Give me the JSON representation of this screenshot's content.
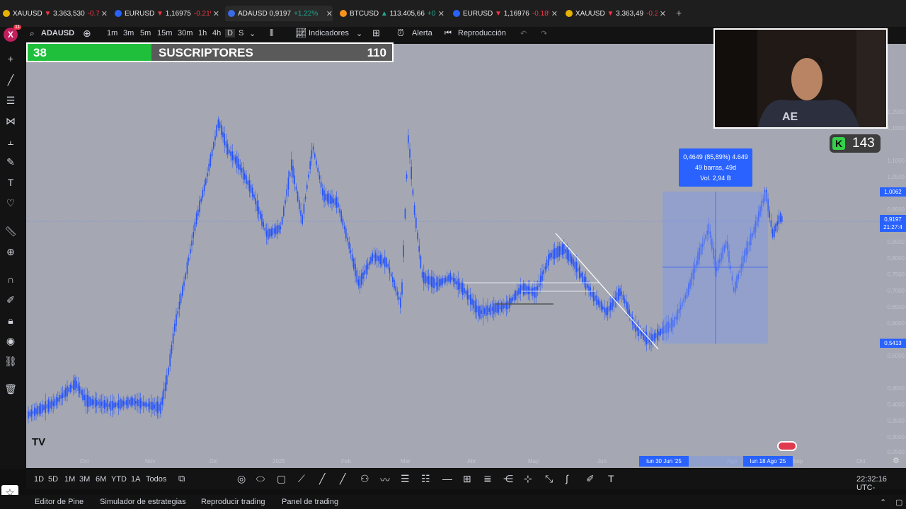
{
  "tabs": [
    {
      "symbol": "XAUUSD",
      "price": "3.363,530",
      "change": "-0.7",
      "dir": "neg",
      "coin": "#e8b200"
    },
    {
      "symbol": "EURUSD",
      "price": "1,16975",
      "change": "-0.21%",
      "dir": "neg",
      "coin": "#2962ff"
    },
    {
      "symbol": "ADAUSD",
      "price": "0,9197",
      "change": "+1.22%",
      "dir": "pos",
      "coin": "#3b6ce8"
    },
    {
      "symbol": "BTCUSD",
      "price": "113.405,66",
      "change": "+0.0",
      "dir": "pos",
      "coin": "#f7931a"
    },
    {
      "symbol": "EURUSD",
      "price": "1,16976",
      "change": "-0.18%",
      "dir": "neg",
      "coin": "#2962ff"
    },
    {
      "symbol": "XAUUSD",
      "price": "3.363,49",
      "change": "-0.2",
      "dir": "neg",
      "coin": "#e8b200"
    }
  ],
  "toolbar": {
    "badge": "11",
    "symbol": "ADAUSD",
    "timeframes": [
      "1m",
      "3m",
      "5m",
      "15m",
      "30m",
      "1h",
      "4h",
      "D",
      "S"
    ],
    "indicators": "Indicadores",
    "alert": "Alerta",
    "replay": "Reproducción"
  },
  "overlay": {
    "current": "38",
    "label": "SUSCRIPTORES",
    "goal": "110",
    "kick_count": "143"
  },
  "chart": {
    "measure_line1": "0,4649 (85,89%) 4.649",
    "measure_line2": "49 barras, 49d",
    "measure_line3": "Vol. 2,94 B",
    "price_high": "1,0062",
    "price_current": "0,9197",
    "countdown": "21:27:4",
    "price_low": "0,5413",
    "date_start": "lun 30 Jun '25",
    "date_end": "lun 18 Ago '25",
    "price_ticks": [
      "1,2500",
      "1,1500",
      "1,1000",
      "1,0500",
      "0,9500",
      "0,8500",
      "0,8000",
      "0,7500",
      "0,7000",
      "0,6500",
      "0,6000",
      "0,5000",
      "0,4500",
      "0,4000",
      "0,3500",
      "0,3000",
      "0,2500"
    ],
    "time_ticks": [
      "Oct",
      "Nov",
      "Dic",
      "2025",
      "Feb",
      "Mar",
      "Abr",
      "May",
      "Jun",
      "Ago",
      "Sep",
      "Oct"
    ]
  },
  "bottom": {
    "ranges": [
      "1D",
      "5D",
      "1M",
      "3M",
      "6M",
      "YTD",
      "1A",
      "Todos"
    ],
    "clock": "22:32:16 UTC-"
  },
  "footer": {
    "tabs": [
      "Editor de Pine",
      "Simulador de estrategias",
      "Reproducir trading",
      "Panel de trading"
    ]
  },
  "colors": {
    "accent": "#2962ff",
    "up": "#22ab94",
    "down": "#f23645",
    "candle": "#2453ff"
  }
}
